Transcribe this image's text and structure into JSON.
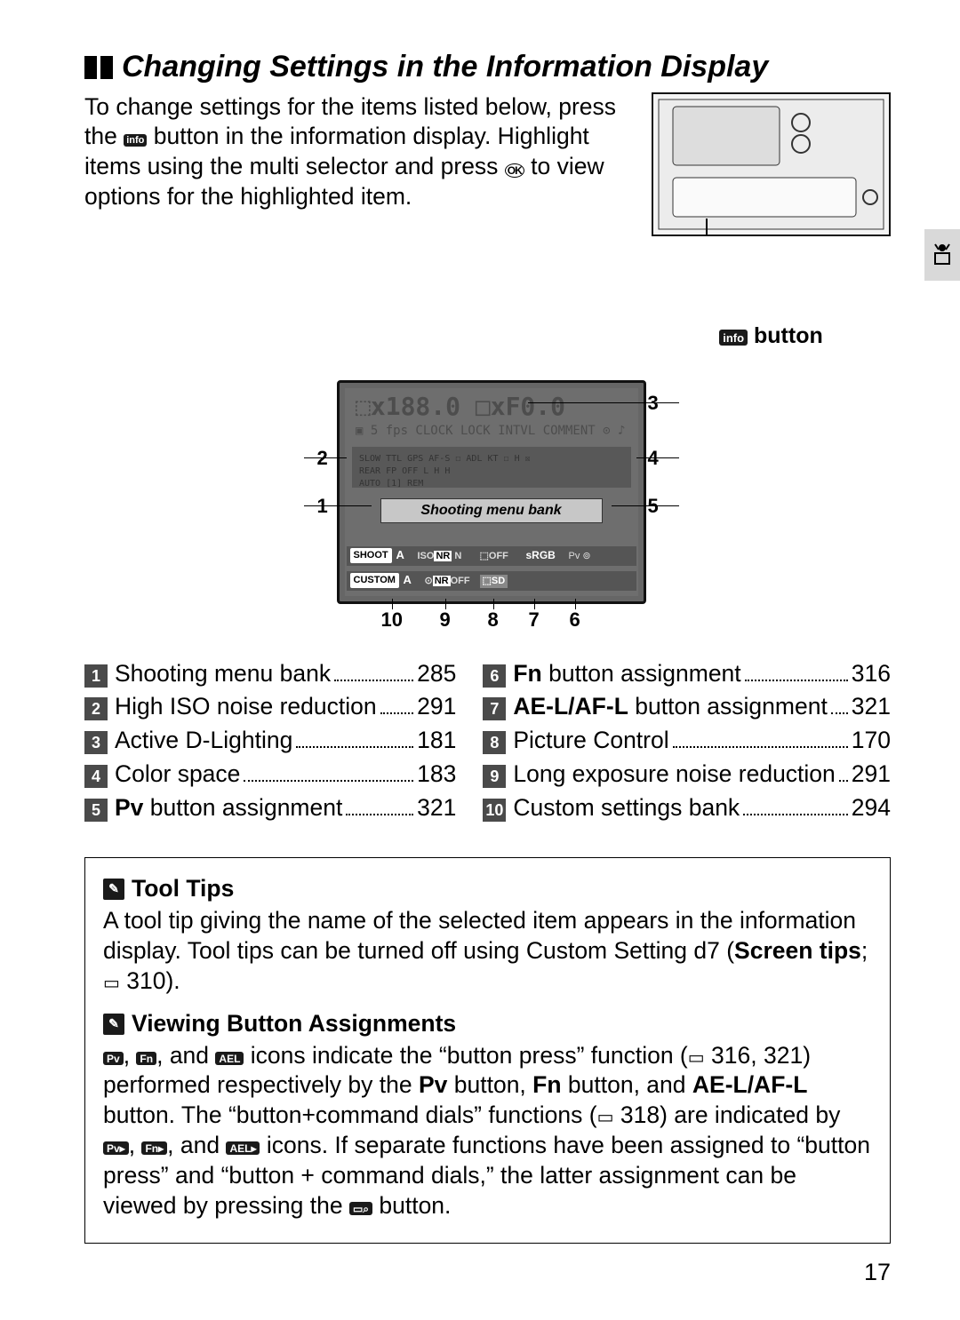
{
  "page_number": "17",
  "heading": "Changing Settings in the Information Display",
  "intro": {
    "line1_a": "To change settings for the items listed below, press the ",
    "info_icon": "info",
    "line1_b": " button in the information display.  Highlight items using the multi selector and press ",
    "ok_icon": "OK",
    "line1_c": " to view options for the highlighted item."
  },
  "cam_caption": " button",
  "display": {
    "menu_bank": "Shooting menu bank",
    "shoot_chip": "SHOOT",
    "custom_chip": "CUSTOM",
    "srgb": "sRGB",
    "labels": {
      "1": "1",
      "2": "2",
      "3": "3",
      "4": "4",
      "5": "5",
      "6": "6",
      "7": "7",
      "8": "8",
      "9": "9",
      "10": "10"
    }
  },
  "legend_left": [
    {
      "n": "1",
      "label": "Shooting menu bank",
      "page": "285",
      "bold": ""
    },
    {
      "n": "2",
      "label": "High ISO noise reduction",
      "page": "291",
      "bold": ""
    },
    {
      "n": "3",
      "label": "Active D-Lighting",
      "page": "181",
      "bold": ""
    },
    {
      "n": "4",
      "label": "Color space",
      "page": "183",
      "bold": ""
    },
    {
      "n": "5",
      "label": " button assignment ",
      "page": "321",
      "bold": "Pv"
    }
  ],
  "legend_right": [
    {
      "n": "6",
      "label": " button assignment",
      "page": "316",
      "bold": "Fn"
    },
    {
      "n": "7",
      "label": " button assignment",
      "page": "321",
      "bold": "AE-L/AF-L"
    },
    {
      "n": "8",
      "label": "Picture Control",
      "page": "170",
      "bold": ""
    },
    {
      "n": "9",
      "label": "Long exposure noise reduction ",
      "page": "291",
      "bold": ""
    },
    {
      "n": "10",
      "label": "Custom settings bank",
      "page": "294",
      "bold": ""
    }
  ],
  "tips": {
    "tool_tips_head": "Tool Tips",
    "tool_tips_body_a": "A tool tip giving the name of the selected item appears in the information display.  Tool tips can be turned off using Custom Setting d7 (",
    "tool_tips_bold": "Screen tips",
    "tool_tips_body_b": "; ",
    "tool_tips_page": " 310).",
    "vba_head": "Viewing Button Assignments",
    "vba_a": ", ",
    "vba_b": ", and ",
    "vba_c": " icons indicate the “button press” function (",
    "vba_pages1": " 316, 321) performed respectively by the ",
    "vba_pv": "Pv",
    "vba_d": " button, ",
    "vba_fn": "Fn",
    "vba_e": " button, and ",
    "vba_ael": "AE-L/AF-L",
    "vba_f": " button.  The “button+command dials” functions (",
    "vba_pages2": " 318) are indicated by ",
    "vba_g": ", ",
    "vba_h": ", and ",
    "vba_i": " icons.  If separate functions have been assigned to “button press” and “button + command dials,” the latter assignment can be viewed by pressing the ",
    "vba_j": " button."
  },
  "icons": {
    "pencil": "✎",
    "book": "▭",
    "pv_chip": "Pv",
    "fn_chip": "Fn",
    "ael_chip": "AEL",
    "dial": "◧",
    "zoom": "⌕"
  }
}
